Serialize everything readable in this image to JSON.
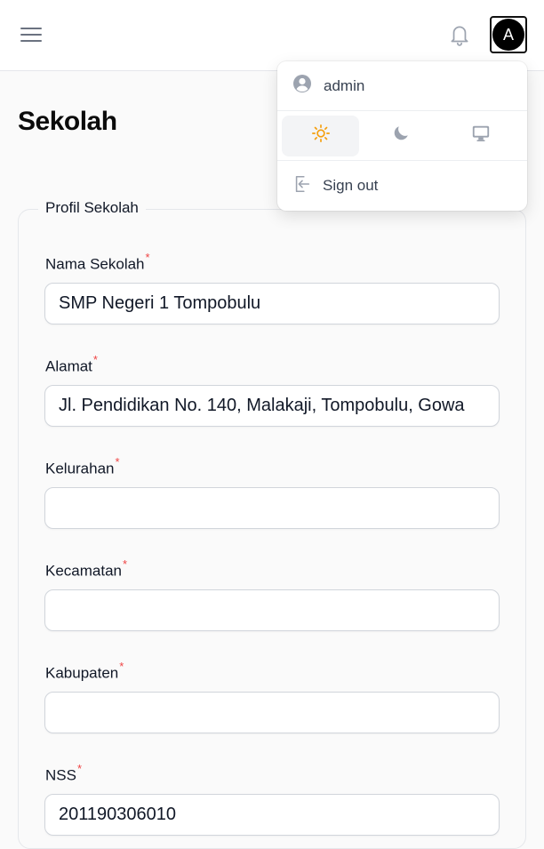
{
  "header": {
    "avatar_initial": "A"
  },
  "page": {
    "title": "Sekolah"
  },
  "user_menu": {
    "username": "admin",
    "theme_options": [
      {
        "name": "light",
        "icon": "sun-icon",
        "active": true
      },
      {
        "name": "dark",
        "icon": "moon-icon",
        "active": false
      },
      {
        "name": "system",
        "icon": "monitor-icon",
        "active": false
      }
    ],
    "sign_out_label": "Sign out"
  },
  "form": {
    "section_legend": "Profil Sekolah",
    "required_mark": "*",
    "fields": [
      {
        "label": "Nama Sekolah",
        "value": "SMP Negeri 1 Tompobulu",
        "required": true
      },
      {
        "label": "Alamat",
        "value": "Jl. Pendidikan No. 140, Malakaji, Tompobulu, Gowa",
        "required": true
      },
      {
        "label": "Kelurahan",
        "value": "",
        "required": true
      },
      {
        "label": "Kecamatan",
        "value": "",
        "required": true
      },
      {
        "label": "Kabupaten",
        "value": "",
        "required": true
      },
      {
        "label": "NSS",
        "value": "201190306010",
        "required": true
      }
    ]
  },
  "colors": {
    "accent_sun": "#f59e0b",
    "required": "#ef4444"
  }
}
